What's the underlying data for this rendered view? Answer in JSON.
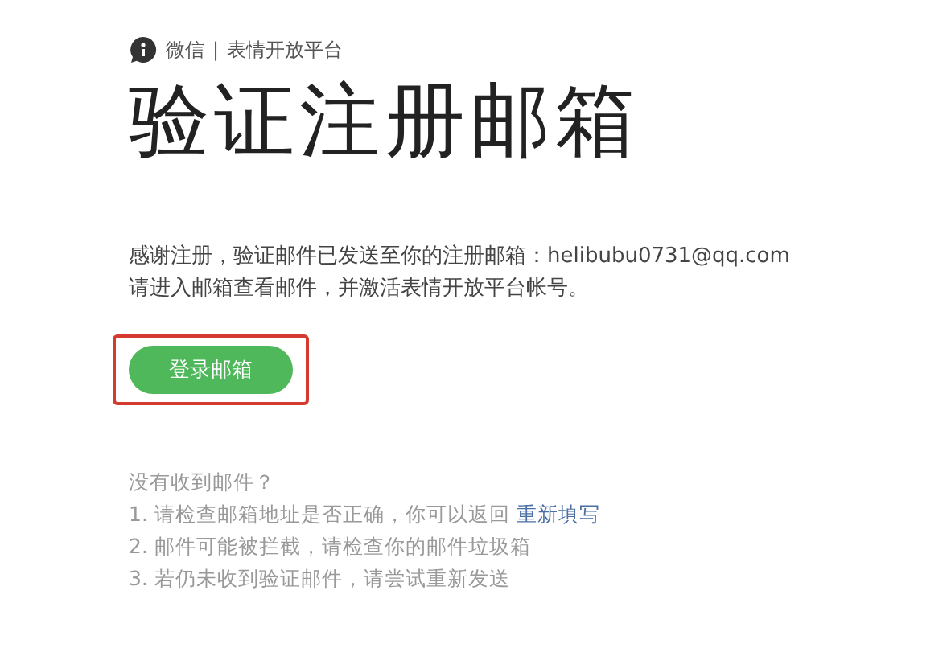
{
  "brand": {
    "name": "微信",
    "divider": "|",
    "product": "表情开放平台"
  },
  "title": "验证注册邮箱",
  "message": {
    "line_1": "感谢注册，验证邮件已发送至你的注册邮箱：",
    "email": "helibubu0731@qq.com",
    "line_2": "请进入邮箱查看邮件，并激活表情开放平台帐号。"
  },
  "login_button": {
    "label": "登录邮箱",
    "highlighted": true
  },
  "help": {
    "heading": "没有收到邮件？",
    "tips": [
      {
        "text": "1. 请检查邮箱地址是否正确，你可以返回 ",
        "link": "重新填写"
      },
      {
        "text": "2. 邮件可能被拦截，请检查你的邮件垃圾箱"
      },
      {
        "text": "3. 若仍未收到验证邮件，请尝试重新发送"
      }
    ]
  }
}
